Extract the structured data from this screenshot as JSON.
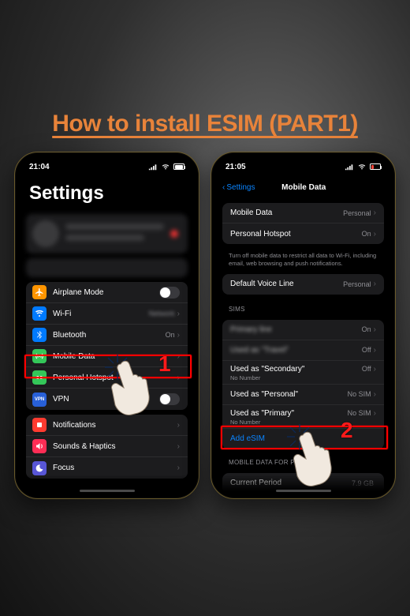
{
  "title": "How to install ESIM (PART1)",
  "annotations": {
    "step1": "1",
    "step2": "2"
  },
  "phone1": {
    "time": "21:04",
    "heading": "Settings",
    "rows": {
      "airplane": "Airplane Mode",
      "wifi": "Wi-Fi",
      "bluetooth": "Bluetooth",
      "bluetooth_value": "On",
      "mobile_data": "Mobile Data",
      "hotspot": "Personal Hotspot",
      "vpn": "VPN",
      "notifications": "Notifications",
      "sounds": "Sounds & Haptics",
      "focus": "Focus"
    }
  },
  "phone2": {
    "time": "21:05",
    "back": "Settings",
    "nav_title": "Mobile Data",
    "rows": {
      "mobile_data": "Mobile Data",
      "mobile_data_value": "Personal",
      "hotspot": "Personal Hotspot",
      "hotspot_value": "On",
      "footnote": "Turn off mobile data to restrict all data to Wi-Fi, including email, web browsing and push notifications.",
      "default_voice": "Default Voice Line",
      "default_voice_value": "Personal",
      "sims_header": "SIMs",
      "sim0_value": "On",
      "sim1_label": "Used as \"Travel\"",
      "sim1_value": "Off",
      "sim2_label": "Used as \"Secondary\"",
      "sim2_sub": "No Number",
      "sim2_value": "Off",
      "sim3_label": "Used as \"Personal\"",
      "sim3_value": "No SIM",
      "sim4_label": "Used as \"Primary\"",
      "sim4_sub": "No Number",
      "sim4_value": "No SIM",
      "add_esim": "Add eSIM",
      "usage_header": "Mobile Data for Person",
      "current_period": "Current Period",
      "current_period_value": "7.9 GB"
    }
  }
}
